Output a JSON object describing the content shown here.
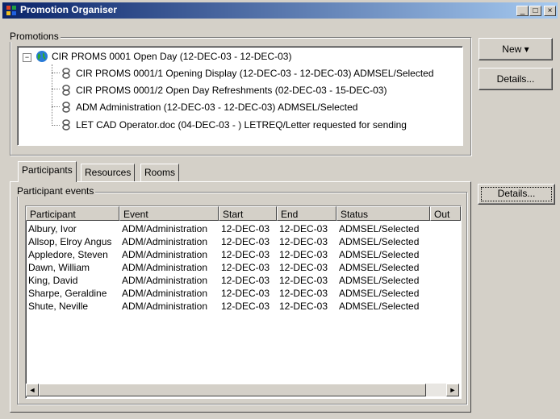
{
  "window": {
    "title": "Promotion Organiser",
    "minimize": "_",
    "maximize": "□",
    "close": "×"
  },
  "promotions": {
    "label": "Promotions",
    "root": {
      "text": "CIR PROMS 0001 Open Day (12-DEC-03 - 12-DEC-03)",
      "expander": "−"
    },
    "children": [
      {
        "text": "CIR PROMS 0001/1 Opening Display (12-DEC-03 - 12-DEC-03) ADMSEL/Selected"
      },
      {
        "text": "CIR PROMS 0001/2 Open Day Refreshments (02-DEC-03 - 15-DEC-03)"
      },
      {
        "text": "ADM Administration (12-DEC-03 - 12-DEC-03) ADMSEL/Selected"
      },
      {
        "text": "LET CAD Operator.doc (04-DEC-03 - ) LETREQ/Letter requested for sending"
      }
    ],
    "new_button": "New",
    "new_arrow": "▾",
    "details_button": "Details..."
  },
  "tabs": [
    {
      "label": "Participants",
      "active": true
    },
    {
      "label": "Resources",
      "active": false
    },
    {
      "label": "Rooms",
      "active": false
    }
  ],
  "participant_events": {
    "label": "Participant events",
    "details_button": "Details...",
    "columns": [
      "Participant",
      "Event",
      "Start",
      "End",
      "Status",
      "Out"
    ],
    "rows": [
      [
        "Albury, Ivor",
        "ADM/Administration",
        "12-DEC-03",
        "12-DEC-03",
        "ADMSEL/Selected"
      ],
      [
        "Allsop, Elroy Angus",
        "ADM/Administration",
        "12-DEC-03",
        "12-DEC-03",
        "ADMSEL/Selected"
      ],
      [
        "Appledore, Steven",
        "ADM/Administration",
        "12-DEC-03",
        "12-DEC-03",
        "ADMSEL/Selected"
      ],
      [
        "Dawn, William",
        "ADM/Administration",
        "12-DEC-03",
        "12-DEC-03",
        "ADMSEL/Selected"
      ],
      [
        "King, David",
        "ADM/Administration",
        "12-DEC-03",
        "12-DEC-03",
        "ADMSEL/Selected"
      ],
      [
        "Sharpe, Geraldine",
        "ADM/Administration",
        "12-DEC-03",
        "12-DEC-03",
        "ADMSEL/Selected"
      ],
      [
        "Shute, Neville",
        "ADM/Administration",
        "12-DEC-03",
        "12-DEC-03",
        "ADMSEL/Selected"
      ]
    ],
    "scroll_left": "◄",
    "scroll_right": "►"
  },
  "colors": {
    "title_start": "#0a246a",
    "title_end": "#a6caf0",
    "face": "#d4d0c8"
  }
}
